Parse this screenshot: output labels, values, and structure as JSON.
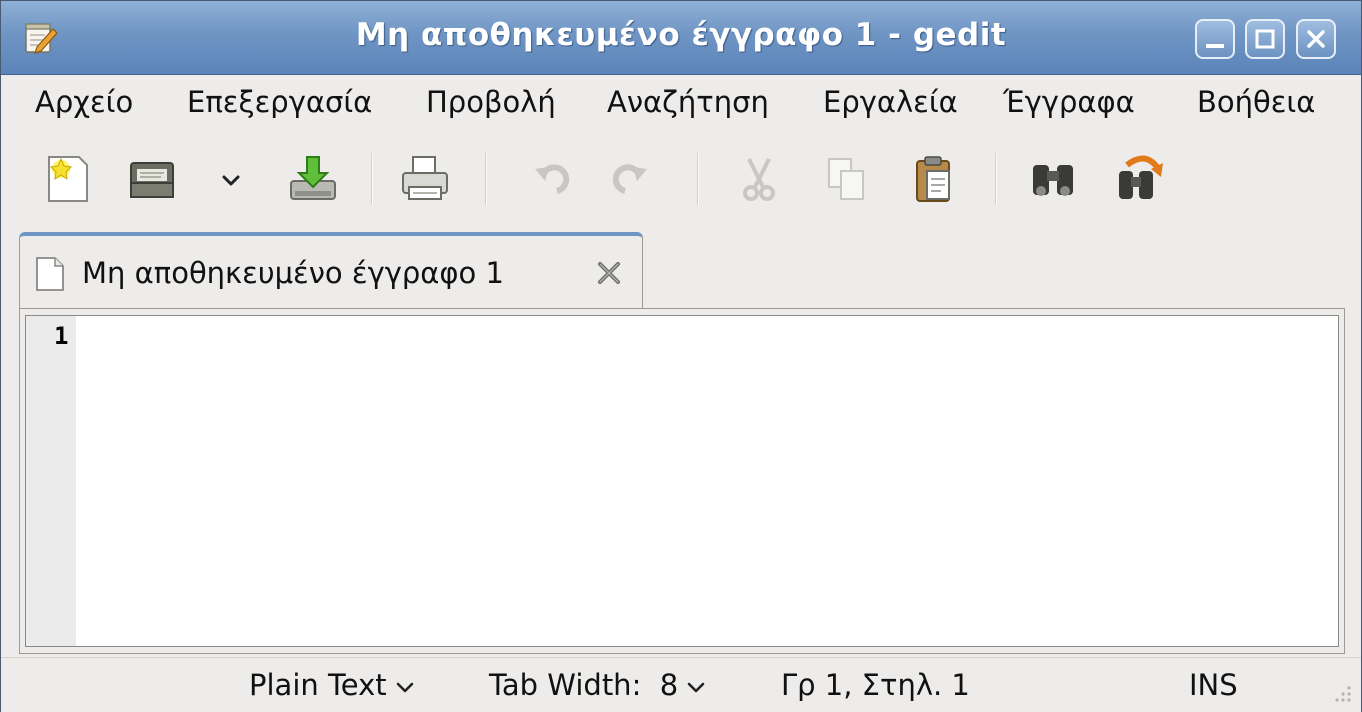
{
  "window": {
    "title": "Μη αποθηκευμένο έγγραφο 1 - gedit",
    "app_icon": "gedit-notepad-icon",
    "controls": [
      "minimize-icon",
      "maximize-icon",
      "close-icon"
    ]
  },
  "menubar": {
    "items": [
      {
        "label": "Αρχείο"
      },
      {
        "label": "Επεξεργασία"
      },
      {
        "label": "Προβολή"
      },
      {
        "label": "Αναζήτηση"
      },
      {
        "label": "Εργαλεία"
      },
      {
        "label": "Έγγραφα"
      },
      {
        "label": "Βοήθεια"
      }
    ]
  },
  "toolbar": {
    "buttons": [
      {
        "icon": "new-document-icon",
        "enabled": true
      },
      {
        "icon": "open-folder-icon",
        "enabled": true
      },
      {
        "icon": "chevron-down-icon",
        "enabled": true
      },
      {
        "icon": "save-icon",
        "enabled": true
      },
      {
        "icon": "print-icon",
        "enabled": true
      },
      {
        "icon": "undo-icon",
        "enabled": false
      },
      {
        "icon": "redo-icon",
        "enabled": false
      },
      {
        "icon": "cut-icon",
        "enabled": false
      },
      {
        "icon": "copy-icon",
        "enabled": false
      },
      {
        "icon": "paste-icon",
        "enabled": true
      },
      {
        "icon": "find-icon",
        "enabled": true
      },
      {
        "icon": "find-replace-icon",
        "enabled": true
      }
    ]
  },
  "tabs": [
    {
      "label": "Μη αποθηκευμένο έγγραφο 1",
      "active": true
    }
  ],
  "editor": {
    "line_numbers": [
      "1"
    ],
    "content": ""
  },
  "statusbar": {
    "language": "Plain Text",
    "tab_width": "Tab Width:  8",
    "position": "Γρ 1, Στηλ. 1",
    "mode": "INS"
  },
  "colors": {
    "titlebar": "#6f95c4",
    "background": "#edeceb",
    "editor": "#ffffff"
  }
}
